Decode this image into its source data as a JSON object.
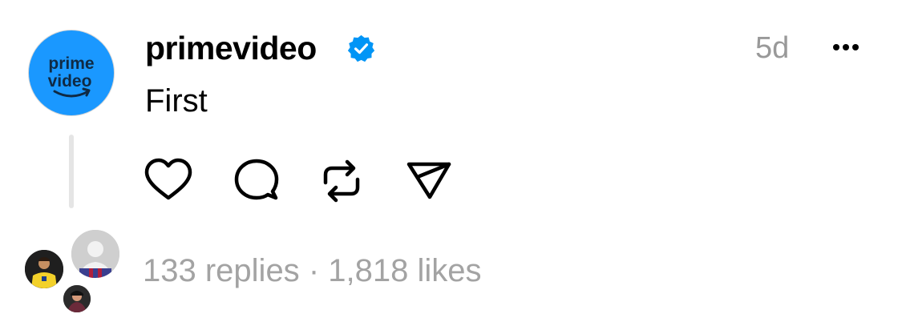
{
  "post": {
    "username": "primevideo",
    "verified": true,
    "timestamp": "5d",
    "text": "First",
    "avatar_logo": {
      "line1": "prime",
      "line2": "video"
    },
    "actions": [
      "like",
      "comment",
      "repost",
      "share"
    ],
    "replies_count": "133 replies",
    "separator": "·",
    "likes_count": "1,818 likes"
  },
  "colors": {
    "avatar_bg": "#1a98ff",
    "verified_badge": "#0095f6",
    "muted_text": "#999999",
    "thread_line": "#e5e5e5"
  },
  "icons": {
    "more": "ellipsis-icon",
    "like": "heart-icon",
    "comment": "speech-bubble-icon",
    "repost": "repost-arrows-icon",
    "share": "paper-plane-icon"
  }
}
